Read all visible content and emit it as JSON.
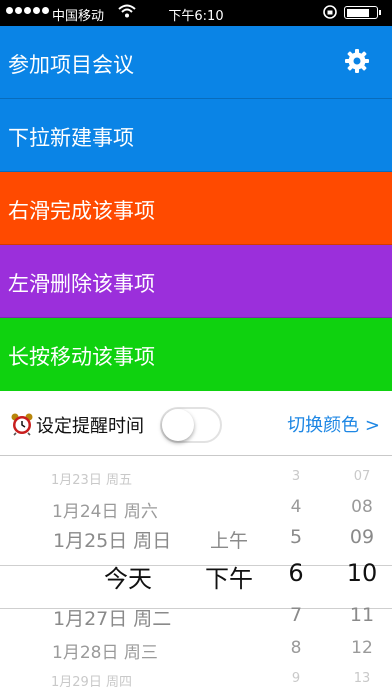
{
  "status": {
    "carrier": "中国移动",
    "time": "下午6:10",
    "battery_level": 0.85
  },
  "rows": [
    {
      "label": "参加项目会议",
      "color": "#0a84e6"
    },
    {
      "label": "下拉新建事项",
      "color": "#0a84e6"
    },
    {
      "label": "右滑完成该事项",
      "color": "#ff4a00"
    },
    {
      "label": "左滑删除该事项",
      "color": "#9b2fdb"
    },
    {
      "label": "长按移动该事项",
      "color": "#0fd20f"
    }
  ],
  "settings": {
    "reminder_label": "设定提醒时间",
    "reminder_on": false,
    "switch_color_label": "切换颜色 >"
  },
  "picker": {
    "dates": [
      "1月23日 周五",
      "1月24日 周六",
      "1月25日 周日",
      "今天",
      "1月27日 周二",
      "1月28日 周三",
      "1月29日 周四"
    ],
    "ampm": [
      "上午",
      "下午"
    ],
    "hours": [
      "3",
      "4",
      "5",
      "6",
      "7",
      "8",
      "9"
    ],
    "minutes": [
      "07",
      "08",
      "09",
      "10",
      "11",
      "12",
      "13"
    ]
  }
}
